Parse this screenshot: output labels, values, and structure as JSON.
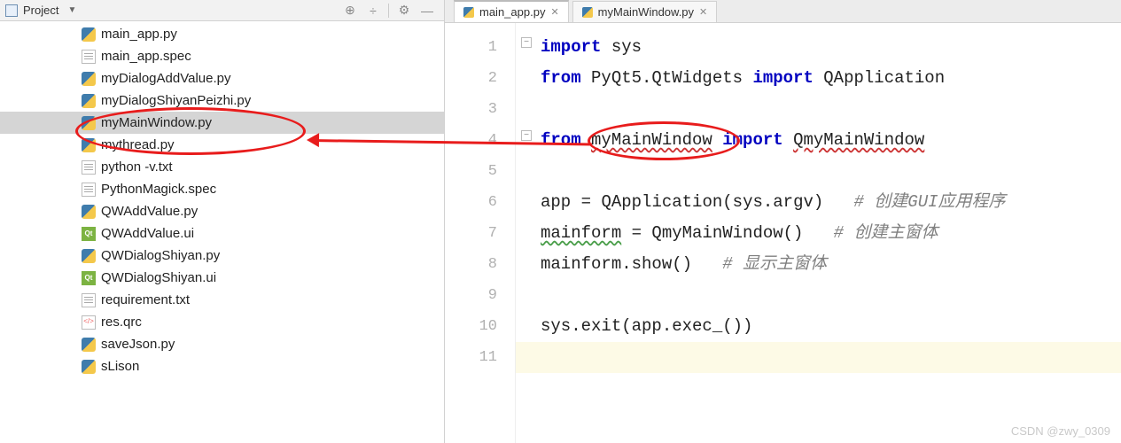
{
  "header": {
    "project_label": "Project"
  },
  "tree": {
    "items": [
      {
        "name": "main_app.py",
        "icon": "py"
      },
      {
        "name": "main_app.spec",
        "icon": "spec"
      },
      {
        "name": "myDialogAddValue.py",
        "icon": "py"
      },
      {
        "name": "myDialogShiyanPeizhi.py",
        "icon": "py"
      },
      {
        "name": "myMainWindow.py",
        "icon": "py",
        "selected": true
      },
      {
        "name": "mythread.py",
        "icon": "py"
      },
      {
        "name": "python -v.txt",
        "icon": "txt"
      },
      {
        "name": "PythonMagick.spec",
        "icon": "spec"
      },
      {
        "name": "QWAddValue.py",
        "icon": "py"
      },
      {
        "name": "QWAddValue.ui",
        "icon": "ui"
      },
      {
        "name": "QWDialogShiyan.py",
        "icon": "py"
      },
      {
        "name": "QWDialogShiyan.ui",
        "icon": "ui"
      },
      {
        "name": "requirement.txt",
        "icon": "txt"
      },
      {
        "name": "res.qrc",
        "icon": "qrc"
      },
      {
        "name": "saveJson.py",
        "icon": "py"
      },
      {
        "name": "sLison",
        "icon": "py"
      }
    ]
  },
  "tabs": [
    {
      "label": "main_app.py",
      "active": true
    },
    {
      "label": "myMainWindow.py",
      "active": false
    }
  ],
  "editor": {
    "lines": [
      {
        "n": "1",
        "tokens": [
          {
            "t": "import ",
            "c": "kw"
          },
          {
            "t": "sys"
          }
        ]
      },
      {
        "n": "2",
        "tokens": [
          {
            "t": "from ",
            "c": "kw"
          },
          {
            "t": "PyQt5.QtWidgets "
          },
          {
            "t": "import ",
            "c": "kw"
          },
          {
            "t": "QApplication"
          }
        ]
      },
      {
        "n": "3",
        "tokens": []
      },
      {
        "n": "4",
        "tokens": [
          {
            "t": "from ",
            "c": "kw"
          },
          {
            "t": "myMainWindow",
            "c": "hl"
          },
          {
            "t": " "
          },
          {
            "t": "import ",
            "c": "kw"
          },
          {
            "t": "QmyMainWindow",
            "c": "hl"
          }
        ]
      },
      {
        "n": "5",
        "tokens": []
      },
      {
        "n": "6",
        "tokens": [
          {
            "t": "app"
          },
          {
            "t": " = "
          },
          {
            "t": "QApplication(sys.argv)   "
          },
          {
            "t": "# 创建GUI应用程序",
            "c": "cm"
          }
        ]
      },
      {
        "n": "7",
        "tokens": [
          {
            "t": "mainform",
            "c": "gu"
          },
          {
            "t": " = QmyMainWindow()   "
          },
          {
            "t": "# 创建主窗体",
            "c": "cm"
          }
        ]
      },
      {
        "n": "8",
        "tokens": [
          {
            "t": "mainform.show()   "
          },
          {
            "t": "# 显示主窗体",
            "c": "cm"
          }
        ]
      },
      {
        "n": "9",
        "tokens": []
      },
      {
        "n": "10",
        "tokens": [
          {
            "t": "sys.exit(app.exec_())"
          }
        ]
      },
      {
        "n": "11",
        "tokens": [],
        "current": true
      }
    ]
  },
  "watermark": "CSDN @zwy_0309",
  "ui_label": "Qt"
}
